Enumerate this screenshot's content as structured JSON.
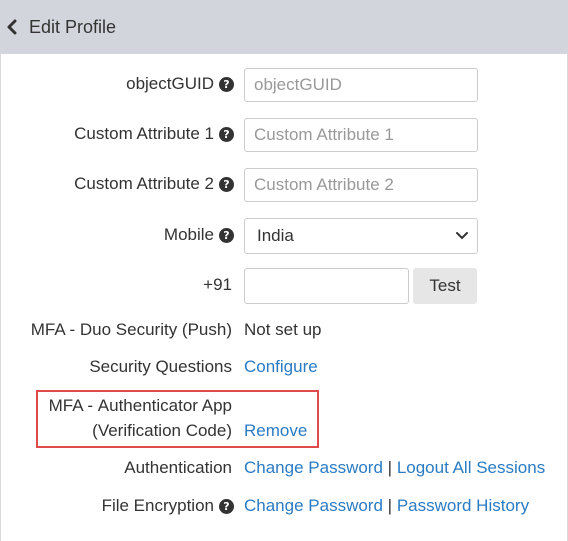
{
  "header": {
    "title": "Edit Profile",
    "back_icon": "chevron-left-icon"
  },
  "fields": {
    "object_guid": {
      "label": "objectGUID",
      "placeholder": "objectGUID"
    },
    "custom_attr_1": {
      "label": "Custom Attribute 1",
      "placeholder": "Custom Attribute 1"
    },
    "custom_attr_2": {
      "label": "Custom Attribute 2",
      "placeholder": "Custom Attribute 2"
    },
    "mobile": {
      "label": "Mobile",
      "selected": "India"
    },
    "phone": {
      "label": "+91",
      "value": "",
      "test_label": "Test"
    }
  },
  "mfa_duo": {
    "label_bold": "MFA -",
    "label_rest": " Duo Security (Push)",
    "status": "Not set up"
  },
  "security_questions": {
    "label": "Security Questions",
    "action": "Configure"
  },
  "mfa_authenticator": {
    "label_bold": "MFA -",
    "label_rest_line1": " Authenticator App",
    "label_line2": "(Verification Code)",
    "action": "Remove",
    "highlight_color": "#e04a4a"
  },
  "authentication": {
    "label": "Authentication",
    "change_password": "Change Password",
    "separator": "|",
    "logout_all": "Logout All Sessions"
  },
  "file_encryption": {
    "label": "File Encryption",
    "change_password": "Change Password",
    "separator": "|",
    "password_history": "Password History"
  },
  "colors": {
    "header_bg": "#d2d6dc",
    "link": "#2a7bc4",
    "text": "#333333"
  }
}
